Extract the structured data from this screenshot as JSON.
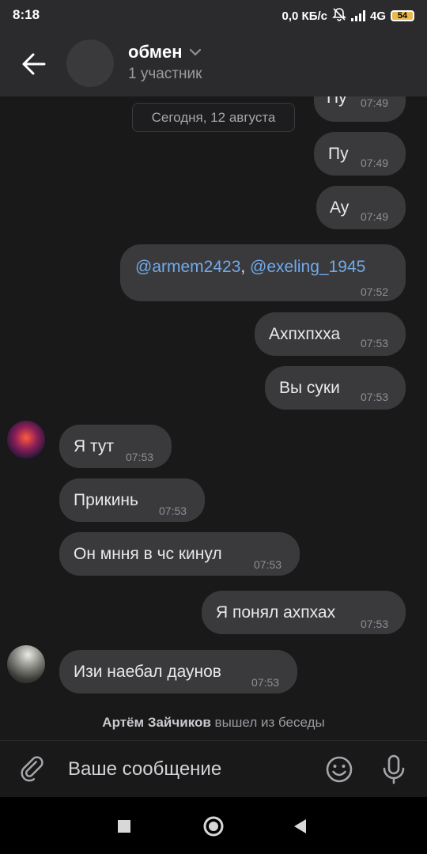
{
  "status_bar": {
    "time": "8:18",
    "net_speed": "0,0 КБ/с",
    "network_type": "4G",
    "battery_level": "54",
    "icons": [
      "mute-bell-icon",
      "signal-icon",
      "battery-icon"
    ]
  },
  "header": {
    "title": "обмен",
    "subtitle": "1 участник",
    "icons": [
      "back-arrow-icon",
      "chevron-down-icon"
    ]
  },
  "date_divider": "Сегодня, 12 августа",
  "messages": [
    {
      "side": "out",
      "text": "Пу",
      "time": "07:49"
    },
    {
      "side": "out",
      "text": "Пу",
      "time": "07:49"
    },
    {
      "side": "out",
      "text": "Ау",
      "time": "07:49"
    },
    {
      "side": "out",
      "mention1": "@armem2423",
      "separator": ", ",
      "mention2": "@exeling_1945",
      "time": "07:52"
    },
    {
      "side": "out",
      "text": "Ахпхпхха",
      "time": "07:53"
    },
    {
      "side": "out",
      "text": "Вы суки",
      "time": "07:53"
    },
    {
      "side": "in",
      "text": "Я тут",
      "time": "07:53"
    },
    {
      "side": "in",
      "text": "Прикинь",
      "time": "07:53"
    },
    {
      "side": "in",
      "text": "Он мння в чс кинул",
      "time": "07:53"
    },
    {
      "side": "out",
      "text": "Я понял ахпхах",
      "time": "07:53"
    },
    {
      "side": "in",
      "text": "Изи наебал даунов",
      "time": "07:53"
    }
  ],
  "system_message": {
    "user": "Артём Зайчиков",
    "action": " вышел из беседы"
  },
  "composer": {
    "placeholder": "Ваше сообщение",
    "icons": [
      "paperclip-icon",
      "emoji-icon",
      "microphone-icon"
    ]
  },
  "nav_bar": {
    "icons": [
      "recents-square-icon",
      "home-circle-icon",
      "back-triangle-icon"
    ]
  },
  "colors": {
    "background": "#19191a",
    "header": "#2b2b2d",
    "bubble": "#3a3a3c",
    "mention": "#71aaeb",
    "timestamp": "#8d8f94"
  }
}
